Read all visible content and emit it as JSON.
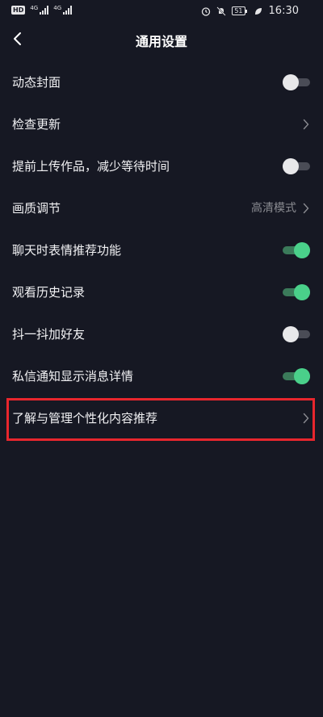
{
  "status_bar": {
    "hd_label": "HD",
    "net1": "4G",
    "net2": "4G",
    "battery": "51",
    "time": "16:30"
  },
  "header": {
    "title": "通用设置"
  },
  "settings": [
    {
      "label": "动态封面",
      "type": "toggle",
      "on": false
    },
    {
      "label": "检查更新",
      "type": "link"
    },
    {
      "label": "提前上传作品，减少等待时间",
      "type": "toggle",
      "on": false
    },
    {
      "label": "画质调节",
      "type": "link",
      "value": "高清模式"
    },
    {
      "label": "聊天时表情推荐功能",
      "type": "toggle",
      "on": true
    },
    {
      "label": "观看历史记录",
      "type": "toggle",
      "on": true
    },
    {
      "label": "抖一抖加好友",
      "type": "toggle",
      "on": false
    },
    {
      "label": "私信通知显示消息详情",
      "type": "toggle",
      "on": true
    },
    {
      "label": "了解与管理个性化内容推荐",
      "type": "link"
    }
  ],
  "colors": {
    "background": "#161823",
    "toggle_on": "#4ad08a",
    "highlight": "#e8262d"
  }
}
